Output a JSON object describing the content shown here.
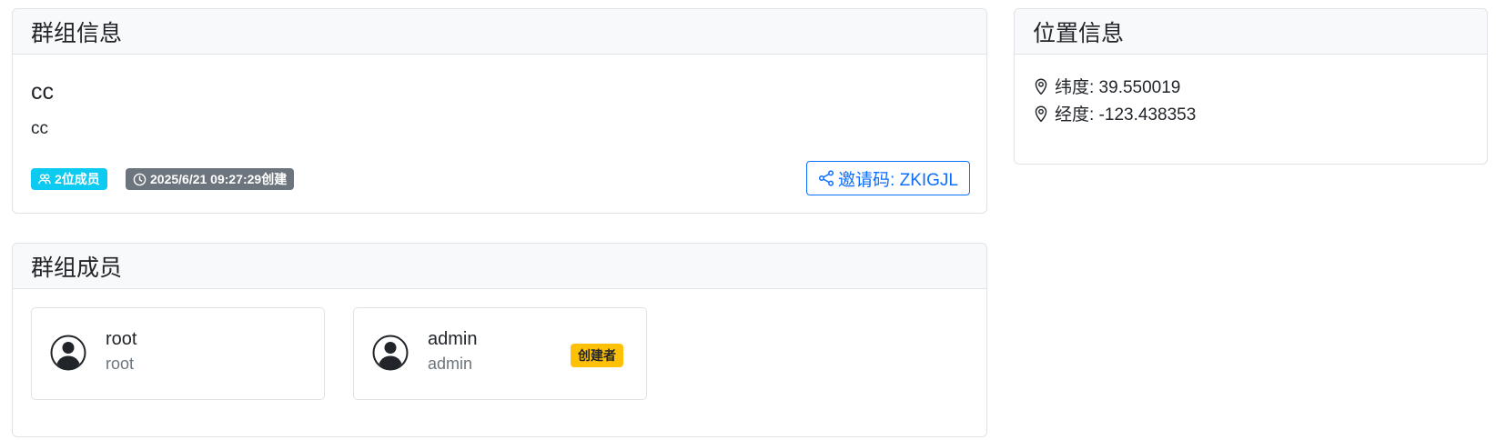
{
  "group_card": {
    "header": "群组信息",
    "name": "cc",
    "description": "cc",
    "members_badge": "2位成员",
    "created_badge": "2025/6/21 09:27:29创建",
    "invite_button": "邀请码: ZKIGJL"
  },
  "location_card": {
    "header": "位置信息",
    "latitude": "纬度: 39.550019",
    "longitude": "经度: -123.438353"
  },
  "members_card": {
    "header": "群组成员",
    "members": [
      {
        "name": "root",
        "username": "root"
      },
      {
        "name": "admin",
        "username": "admin",
        "badge": "创建者"
      }
    ]
  },
  "icons": {
    "members": "people-icon",
    "created": "clock-icon",
    "invite": "share-icon",
    "location": "geo-pin-icon",
    "avatar": "person-circle-icon"
  },
  "colors": {
    "info": "#0dcaf0",
    "secondary": "#6c757d",
    "primary": "#0d6efd",
    "warning": "#ffc107",
    "header_bg": "#f8f9fa",
    "border": "#dfe2e6"
  }
}
